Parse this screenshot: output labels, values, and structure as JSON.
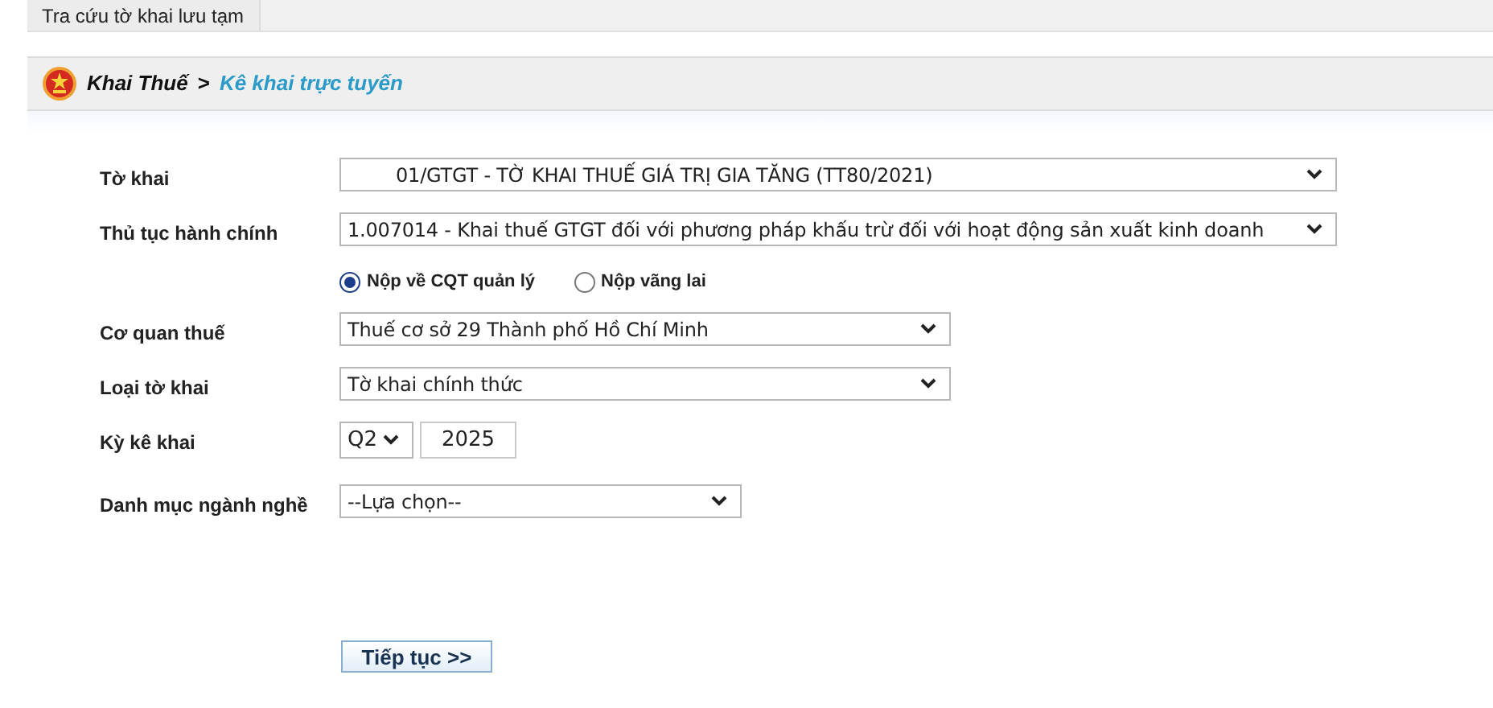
{
  "tabs": [
    {
      "label": "Tra cứu tờ khai lưu tạm"
    }
  ],
  "breadcrumb": {
    "parent": "Khai Thuế",
    "separator": ">",
    "current": "Kê khai trực tuyến"
  },
  "form": {
    "rows": [
      {
        "kind": "select",
        "label": "Tờ khai",
        "value": "01/GTGT - TỜ KHAI THUẾ GIÁ TRỊ GIA TĂNG (TT80/2021)"
      },
      {
        "kind": "select",
        "label": "Thủ tục hành chính",
        "value": "1.007014 - Khai thuế GTGT đối với phương pháp khấu trừ đối với hoạt động sản xuất kinh doanh"
      },
      {
        "kind": "radios",
        "options": [
          {
            "label": "Nộp về CQT quản lý",
            "selected": true
          },
          {
            "label": "Nộp vãng lai",
            "selected": false
          }
        ]
      },
      {
        "kind": "select",
        "label": "Cơ quan thuế",
        "value": "Thuế cơ sở 29 Thành phố Hồ Chí Minh"
      },
      {
        "kind": "select",
        "label": "Loại tờ khai",
        "value": "Tờ khai chính thức"
      },
      {
        "kind": "period",
        "label": "Kỳ kê khai",
        "quarter": "Q2",
        "year": "2025"
      },
      {
        "kind": "select",
        "label": "Danh mục ngành nghề",
        "value": "--Lựa chọn--"
      }
    ]
  },
  "submit": "Tiếp tục >>"
}
